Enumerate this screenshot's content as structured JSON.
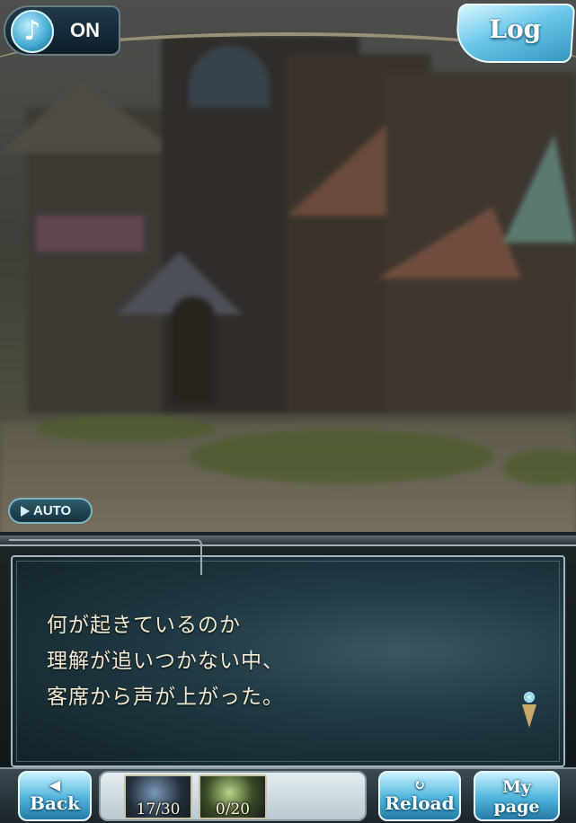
{
  "top_bar": {
    "sound_icon": "music-note-icon",
    "sound_state": "ON",
    "log_label": "Log"
  },
  "auto": {
    "label": "AUTO"
  },
  "dialogue": {
    "lines": [
      "何が起きているのか",
      "理解が追いつかない中、",
      "客席から声が上がった。"
    ]
  },
  "bottom_bar": {
    "back_label": "Back",
    "reload_label": "Reload",
    "mypage_line1": "My",
    "mypage_line2": "page",
    "ap": "17/30",
    "bp": "0/20"
  },
  "colors": {
    "accent": "#4fb4dc",
    "text": "#f3ead2"
  }
}
